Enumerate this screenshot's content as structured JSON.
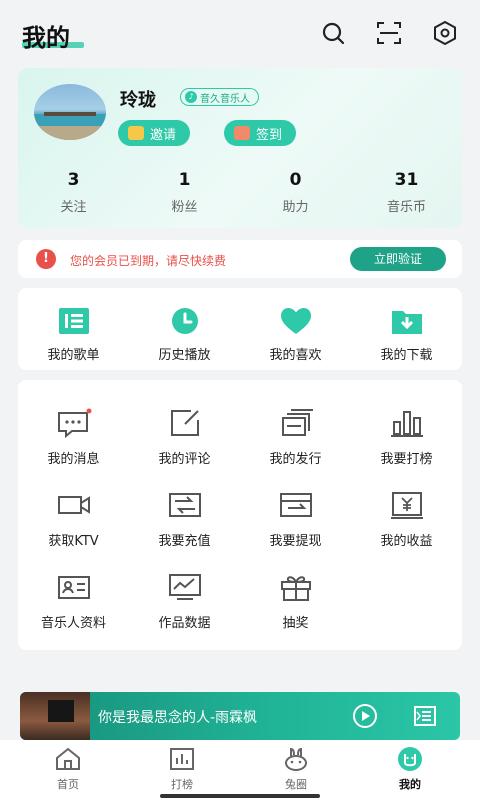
{
  "header": {
    "title": "我的",
    "icons": [
      "search-icon",
      "scan-icon",
      "settings-icon"
    ]
  },
  "profile": {
    "nickname": "玲珑",
    "badge": "音久音乐人",
    "invite_label": "邀请",
    "checkin_label": "签到",
    "stats": [
      {
        "value": "3",
        "label": "关注"
      },
      {
        "value": "1",
        "label": "粉丝"
      },
      {
        "value": "0",
        "label": "助力"
      },
      {
        "value": "31",
        "label": "音乐币"
      }
    ]
  },
  "notice": {
    "message": "您的会员已到期，请尽快续费",
    "action": "立即验证"
  },
  "quick": [
    {
      "label": "我的歌单",
      "icon": "playlist-icon"
    },
    {
      "label": "历史播放",
      "icon": "history-icon"
    },
    {
      "label": "我的喜欢",
      "icon": "heart-icon"
    },
    {
      "label": "我的下载",
      "icon": "download-icon"
    }
  ],
  "grid": [
    {
      "label": "我的消息",
      "icon": "message-icon"
    },
    {
      "label": "我的评论",
      "icon": "comment-icon"
    },
    {
      "label": "我的发行",
      "icon": "release-icon"
    },
    {
      "label": "我要打榜",
      "icon": "chart-icon"
    },
    {
      "label": "获取KTV",
      "icon": "video-icon"
    },
    {
      "label": "我要充值",
      "icon": "recharge-icon"
    },
    {
      "label": "我要提现",
      "icon": "withdraw-icon"
    },
    {
      "label": "我的收益",
      "icon": "earnings-icon"
    },
    {
      "label": "音乐人资料",
      "icon": "profile-card-icon"
    },
    {
      "label": "作品数据",
      "icon": "analytics-icon"
    },
    {
      "label": "抽奖",
      "icon": "gift-icon"
    }
  ],
  "player": {
    "song": "你是我最思念的人-雨霖枫"
  },
  "tabs": [
    {
      "label": "首页",
      "icon": "home-icon"
    },
    {
      "label": "打榜",
      "icon": "chart-tab-icon"
    },
    {
      "label": "兔圈",
      "icon": "rabbit-icon"
    },
    {
      "label": "我的",
      "icon": "me-icon"
    }
  ],
  "colors": {
    "accent": "#2ec9a8",
    "accent_dark": "#1fa388",
    "warning": "#e8504a",
    "background": "#f2f3f5"
  }
}
